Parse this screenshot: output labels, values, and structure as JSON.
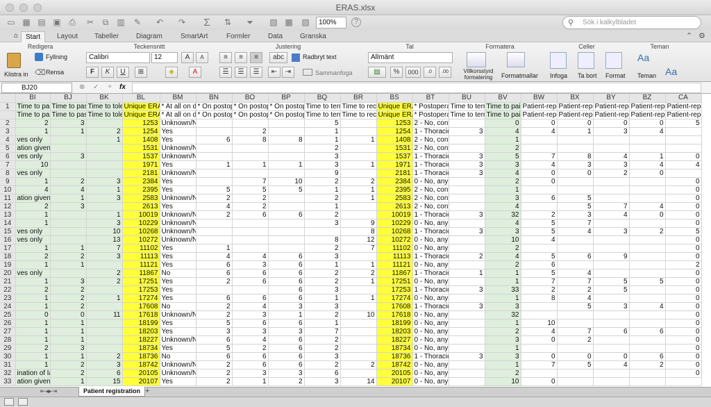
{
  "window": {
    "title": "ERAS.xlsx"
  },
  "toolbar": {
    "zoom": "100%",
    "search_placeholder": "Sök i kalkylbladet"
  },
  "ribbon_tabs": [
    "Start",
    "Layout",
    "Tabeller",
    "Diagram",
    "SmartArt",
    "Formler",
    "Data",
    "Granska"
  ],
  "ribbon": {
    "groups": {
      "redigera": "Redigera",
      "tecken": "Teckensnitt",
      "justering": "Justering",
      "tal": "Tal",
      "formatera": "Formatera",
      "celler": "Celler",
      "teman": "Teman"
    },
    "klistra_in": "Klistra in",
    "fyllning": "Fyllning",
    "rensa": "Rensa",
    "font": "Calibri",
    "size": "12",
    "bold": "F",
    "italic": "K",
    "underline": "U",
    "wrap": "Radbryt text",
    "merge": "Sammanfoga",
    "number_format": "Allmänt",
    "percent": "%",
    "thousands": "000",
    "cond_format": "Villkorsstyrd formatering",
    "format_templates": "Formatmallar",
    "insert": "Infoga",
    "delete": "Ta bort",
    "format": "Format",
    "themes": "Teman",
    "theme_aa": "Aa"
  },
  "formula_bar": {
    "cell_ref": "BJ20",
    "fx": "fx",
    "content": ""
  },
  "grid": {
    "col_headers": [
      "BI",
      "BJ",
      "BK",
      "BL",
      "BM",
      "BN",
      "BO",
      "BP",
      "BQ",
      "BR",
      "BS",
      "BT",
      "BU",
      "BV",
      "BW",
      "BX",
      "BY",
      "BZ",
      "CA"
    ],
    "rows": [
      {
        "n": "1",
        "c": [
          "Time to pass",
          "Time to pass",
          "Time to toler",
          "Unique ERAS",
          "* At all on da",
          "* On postope",
          "* On postope",
          "* On postope",
          "Time to term",
          "Time to reco",
          "Unique ERAS",
          "* Postoperat",
          "Time to term",
          "Time to pain",
          "Patient-repo",
          "Patient-repo",
          "Patient-repo",
          "Patient-repo",
          "Patient-repo"
        ]
      },
      {
        "n": "",
        "c": [
          "Time to pass",
          "Time to pass",
          "Time to toler",
          "Unique ERAS",
          "* At all on da",
          "* On postope",
          "* On postope",
          "* On postope",
          "Time to term",
          "Time to reco",
          "Unique ERAS",
          "* Postoperat",
          "Time to term",
          "Time to pain",
          "Patient-repo",
          "Patient-repo",
          "Patient-repo",
          "Patient-repo",
          "Patient-repo"
        ]
      },
      {
        "n": "2",
        "c": [
          "2",
          "3",
          "",
          "1253",
          "Unknown/Not applicable",
          "",
          "",
          "",
          "5",
          "",
          "1253",
          "2 - No, contraindicated",
          "",
          "0",
          "0",
          "0",
          "0",
          "0",
          "5"
        ]
      },
      {
        "n": "3",
        "c": [
          "1",
          "1",
          "2",
          "1254",
          "Yes",
          "",
          "2",
          "",
          "1",
          "",
          "1254",
          "1 - Thoracic e",
          "3",
          "4",
          "4",
          "1",
          "3",
          "4",
          ""
        ]
      },
      {
        "n": "4",
        "c": [
          "ves only",
          "",
          "1",
          "1408",
          "Yes",
          "6",
          "8",
          "8",
          "1",
          "1",
          "1408",
          "2 - No, contraindicated",
          "",
          "1",
          "",
          "",
          "",
          "",
          ""
        ]
      },
      {
        "n": "5",
        "c": [
          "ation given",
          "",
          "",
          "1531",
          "Unknown/Not applicable",
          "",
          "",
          "",
          "2",
          "",
          "1531",
          "2 - No, contraindicated",
          "",
          "2",
          "",
          "",
          "",
          "",
          ""
        ]
      },
      {
        "n": "6",
        "c": [
          "ves only",
          "3",
          "",
          "1537",
          "Unknown/Not applicable",
          "",
          "",
          "",
          "3",
          "",
          "1537",
          "1 - Thoracic e",
          "3",
          "5",
          "7",
          "8",
          "4",
          "1",
          "0"
        ]
      },
      {
        "n": "7",
        "c": [
          "10",
          "",
          "",
          "1971",
          "Yes",
          "1",
          "1",
          "1",
          "3",
          "1",
          "1971",
          "1 - Thoracic e",
          "3",
          "3",
          "4",
          "3",
          "3",
          "4",
          "4"
        ]
      },
      {
        "n": "8",
        "c": [
          "ves only",
          "",
          "",
          "2181",
          "Unknown/Not applicable",
          "",
          "",
          "",
          "9",
          "",
          "2181",
          "1 - Thoracic e",
          "3",
          "4",
          "0",
          "0",
          "2",
          "0",
          ""
        ]
      },
      {
        "n": "9",
        "c": [
          "1",
          "2",
          "3",
          "2384",
          "Yes",
          "",
          "7",
          "10",
          "2",
          "2",
          "2384",
          "0 - No, any other reason",
          "",
          "2",
          "0",
          "",
          "",
          "",
          "0"
        ]
      },
      {
        "n": "10",
        "c": [
          "4",
          "4",
          "1",
          "2395",
          "Yes",
          "5",
          "5",
          "5",
          "1",
          "1",
          "2395",
          "2 - No, contraindicated",
          "",
          "1",
          "",
          "",
          "",
          "",
          "0"
        ]
      },
      {
        "n": "11",
        "c": [
          "ation given",
          "1",
          "3",
          "2583",
          "Unknown/No",
          "2",
          "2",
          "",
          "2",
          "1",
          "2583",
          "2 - No, contraindicated",
          "",
          "3",
          "6",
          "5",
          "",
          "",
          "0"
        ]
      },
      {
        "n": "12",
        "c": [
          "2",
          "3",
          "",
          "2613",
          "Yes",
          "4",
          "2",
          "",
          "1",
          "",
          "2613",
          "2 - No, contraindicated",
          "",
          "4",
          "",
          "5",
          "7",
          "4",
          "0"
        ]
      },
      {
        "n": "13",
        "c": [
          "1",
          "",
          "1",
          "10019",
          "Unknown/No",
          "2",
          "6",
          "6",
          "2",
          "",
          "10019",
          "1 - Thoracic e",
          "3",
          "32",
          "2",
          "3",
          "4",
          "0",
          "0"
        ]
      },
      {
        "n": "14",
        "c": [
          "1",
          "",
          "3",
          "10229",
          "Unknown/Not applicable",
          "",
          "",
          "",
          "3",
          "9",
          "10229",
          "0 - No, any other reason",
          "",
          "4",
          "5",
          "7",
          "",
          "",
          "0"
        ]
      },
      {
        "n": "15",
        "c": [
          "ves only",
          "",
          "10",
          "10268",
          "Unknown/Not applicable",
          "",
          "",
          "",
          "",
          "8",
          "10268",
          "1 - Thoracic e",
          "3",
          "3",
          "5",
          "4",
          "3",
          "2",
          "5"
        ]
      },
      {
        "n": "16",
        "c": [
          "ves only",
          "",
          "13",
          "10272",
          "Unknown/Not applicable",
          "",
          "",
          "",
          "8",
          "12",
          "10272",
          "0 - No, any other reason",
          "",
          "10",
          "4",
          "",
          "",
          "",
          "0"
        ]
      },
      {
        "n": "17",
        "c": [
          "1",
          "1",
          "7",
          "11102",
          "Yes",
          "1",
          "",
          "",
          "2",
          "7",
          "11102",
          "0 - No, any other reason",
          "",
          "2",
          "",
          "",
          "",
          "",
          "0"
        ]
      },
      {
        "n": "18",
        "c": [
          "2",
          "2",
          "3",
          "11113",
          "Yes",
          "4",
          "4",
          "6",
          "3",
          "",
          "11113",
          "1 - Thoracic e",
          "2",
          "4",
          "5",
          "6",
          "9",
          "",
          "0"
        ]
      },
      {
        "n": "19",
        "c": [
          "1",
          "1",
          "",
          "11121",
          "Yes",
          "6",
          "3",
          "6",
          "1",
          "1",
          "11121",
          "0 - No, any other reason",
          "",
          "2",
          "6",
          "",
          "",
          "",
          "2"
        ]
      },
      {
        "n": "20",
        "c": [
          "ves only",
          "",
          "2",
          "11867",
          "No",
          "6",
          "6",
          "6",
          "2",
          "2",
          "11867",
          "1 - Thoracic e",
          "1",
          "1",
          "5",
          "4",
          "",
          "",
          "0"
        ]
      },
      {
        "n": "21",
        "c": [
          "1",
          "3",
          "2",
          "17251",
          "Yes",
          "2",
          "6",
          "6",
          "2",
          "1",
          "17251",
          "0 - No, any other reason",
          "",
          "1",
          "7",
          "7",
          "5",
          "5",
          "0"
        ]
      },
      {
        "n": "22",
        "c": [
          "2",
          "2",
          "",
          "17253",
          "Yes",
          "",
          "",
          "6",
          "3",
          "",
          "17253",
          "1 - Thoracic e",
          "3",
          "33",
          "2",
          "2",
          "5",
          "",
          "0"
        ]
      },
      {
        "n": "23",
        "c": [
          "1",
          "2",
          "1",
          "17274",
          "Yes",
          "6",
          "6",
          "6",
          "1",
          "1",
          "17274",
          "0 - No, any other reason",
          "",
          "1",
          "8",
          "4",
          "",
          "",
          "0"
        ]
      },
      {
        "n": "24",
        "c": [
          "1",
          "2",
          "",
          "17608",
          "No",
          "2",
          "4",
          "3",
          "3",
          "",
          "17608",
          "1 - Thoracic e",
          "3",
          "3",
          "",
          "5",
          "3",
          "4",
          "0"
        ]
      },
      {
        "n": "25",
        "c": [
          "0",
          "0",
          "11",
          "17618",
          "Unknown/No",
          "2",
          "3",
          "1",
          "2",
          "10",
          "17618",
          "0 - No, any other reason",
          "",
          "32",
          "",
          "",
          "",
          "",
          "0"
        ]
      },
      {
        "n": "26",
        "c": [
          "1",
          "1",
          "",
          "18199",
          "Yes",
          "5",
          "6",
          "6",
          "1",
          "",
          "18199",
          "0 - No, any other reason",
          "",
          "1",
          "10",
          "",
          "",
          "",
          "0"
        ]
      },
      {
        "n": "27",
        "c": [
          "1",
          "1",
          "",
          "18203",
          "Yes",
          "3",
          "3",
          "3",
          "7",
          "",
          "18203",
          "0 - No, any other reason",
          "",
          "2",
          "4",
          "7",
          "6",
          "6",
          "0"
        ]
      },
      {
        "n": "28",
        "c": [
          "1",
          "1",
          "",
          "18227",
          "Unknown/No",
          "6",
          "4",
          "6",
          "2",
          "",
          "18227",
          "0 - No, any other reason",
          "",
          "3",
          "0",
          "2",
          "",
          "",
          "0"
        ]
      },
      {
        "n": "29",
        "c": [
          "2",
          "3",
          "",
          "18734",
          "Yes",
          "5",
          "2",
          "6",
          "2",
          "",
          "18734",
          "0 - No, any other reason",
          "",
          "1",
          "",
          "",
          "",
          "",
          "0"
        ]
      },
      {
        "n": "30",
        "c": [
          "1",
          "1",
          "2",
          "18736",
          "No",
          "6",
          "6",
          "6",
          "3",
          "",
          "18736",
          "1 - Thoracic e",
          "3",
          "3",
          "0",
          "0",
          "0",
          "6",
          "0"
        ]
      },
      {
        "n": "31",
        "c": [
          "1",
          "2",
          "3",
          "18742",
          "Unknown/No",
          "2",
          "6",
          "6",
          "2",
          "2",
          "18742",
          "0 - No, any other reason",
          "",
          "1",
          "7",
          "5",
          "4",
          "2",
          "0"
        ]
      },
      {
        "n": "32",
        "c": [
          "ination of lax",
          "2",
          "6",
          "20105",
          "Unknown/No",
          "2",
          "3",
          "3",
          "6",
          "",
          "20105",
          "0 - No, any other reason",
          "",
          "2",
          "",
          "",
          "",
          "",
          "0"
        ]
      },
      {
        "n": "33",
        "c": [
          "ation given",
          "1",
          "15",
          "20107",
          "Yes",
          "2",
          "1",
          "2",
          "3",
          "14",
          "20107",
          "0 - No, any other reason",
          "",
          "10",
          "0",
          "",
          "",
          "",
          ""
        ]
      }
    ]
  },
  "sheets": [
    "Patient registration"
  ],
  "add_sheet": "+",
  "colors": {
    "ribbon_accent": "#2f6fb3",
    "highlight": "#ffff3a",
    "green_cells": "#dfeedd"
  }
}
